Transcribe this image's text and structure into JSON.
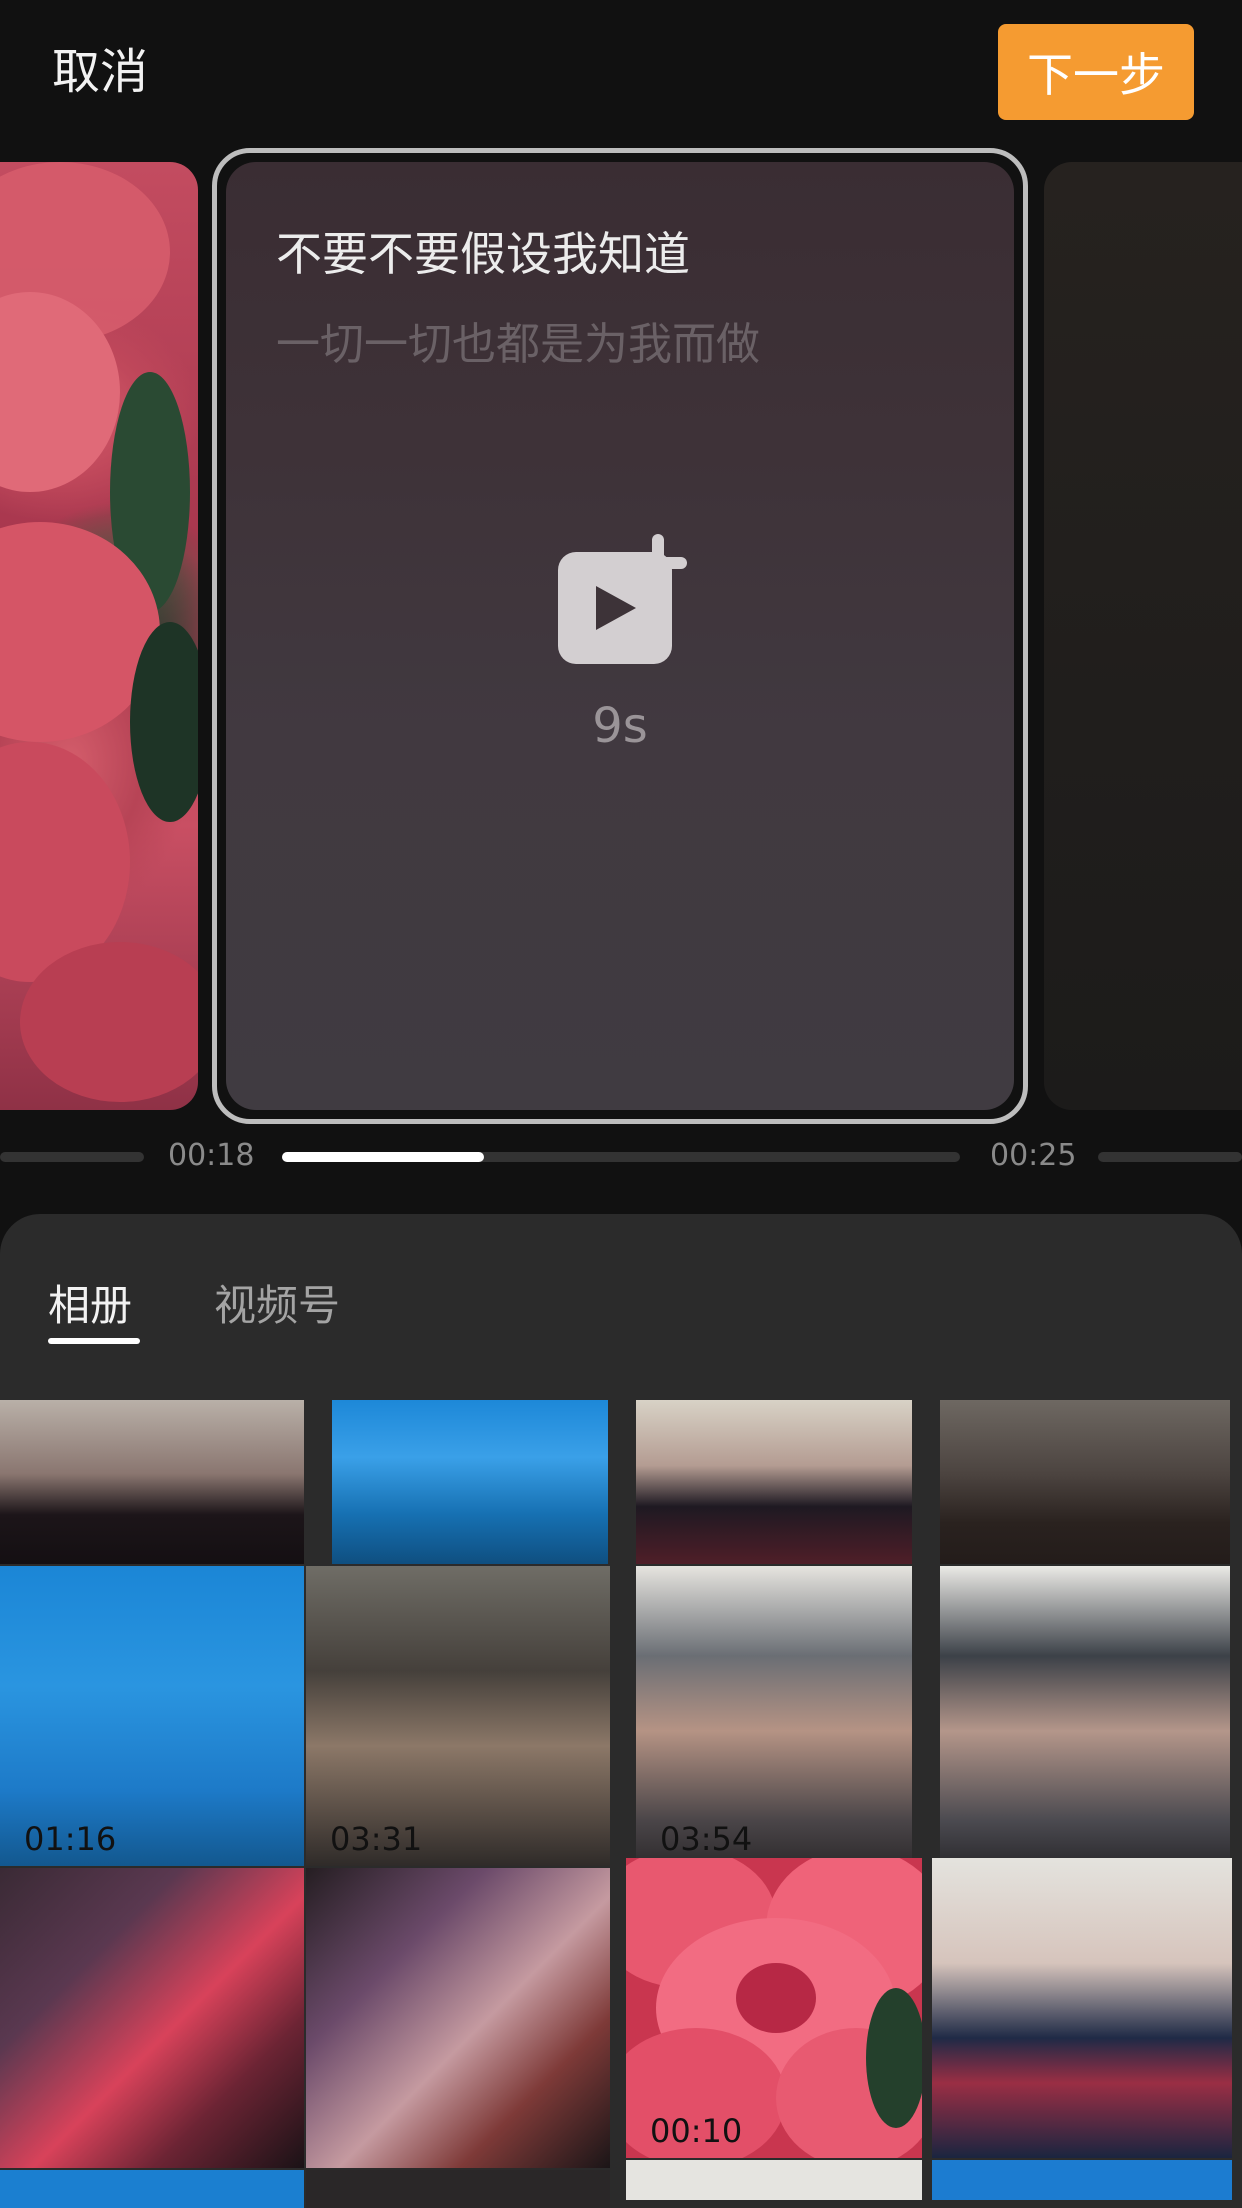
{
  "topbar": {
    "cancel_label": "取消",
    "next_label": "下一步",
    "accent": "#f59b31"
  },
  "editor": {
    "lyric_line_1": "不要不要假设我知道",
    "lyric_line_2": "一切一切也都是为我而做",
    "clip_duration": "9s",
    "add_icon": "add-video-icon"
  },
  "timeline": {
    "time_left": "00:18",
    "time_right": "00:25",
    "progress_fraction": 0.42
  },
  "sheet": {
    "tabs": [
      {
        "label": "相册",
        "active": true
      },
      {
        "label": "视频号",
        "active": false
      }
    ]
  },
  "media": [
    {
      "duration": ""
    },
    {
      "duration": ""
    },
    {
      "duration": ""
    },
    {
      "duration": ""
    },
    {
      "duration": "01:16"
    },
    {
      "duration": "03:31"
    },
    {
      "duration": "03:54"
    },
    {
      "duration": ""
    },
    {
      "duration": ""
    },
    {
      "duration": ""
    },
    {
      "duration": "00:10"
    },
    {
      "duration": ""
    }
  ]
}
